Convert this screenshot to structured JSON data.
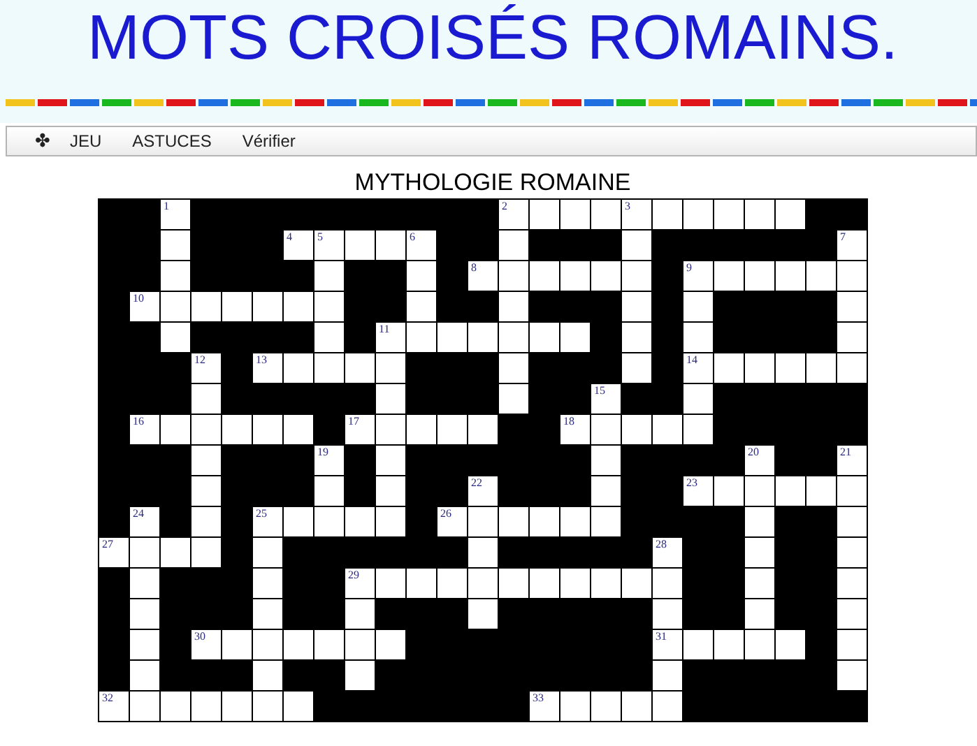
{
  "header": {
    "title": "MOTS CROISÉS ROMAINS."
  },
  "menu": [
    {
      "label": "✤"
    },
    {
      "label": "JEU"
    },
    {
      "label": "ASTUCES"
    },
    {
      "label": "Vérifier"
    }
  ],
  "puzzle": {
    "title": "MYTHOLOGIE ROMAINE",
    "rows": [
      [
        {
          "black": true
        },
        {
          "black": true
        },
        {
          "black": false,
          "number": "1"
        },
        {
          "black": true
        },
        {
          "black": true
        },
        {
          "black": true
        },
        {
          "black": true
        },
        {
          "black": true
        },
        {
          "black": true
        },
        {
          "black": true
        },
        {
          "black": true
        },
        {
          "black": true
        },
        {
          "black": true
        },
        {
          "black": false,
          "number": "2"
        },
        {
          "black": false
        },
        {
          "black": false
        },
        {
          "black": false
        },
        {
          "black": false,
          "number": "3"
        },
        {
          "black": false
        },
        {
          "black": false
        },
        {
          "black": false
        },
        {
          "black": false
        },
        {
          "black": false
        },
        {
          "black": true
        },
        {
          "black": true
        }
      ],
      [
        {
          "black": true
        },
        {
          "black": true
        },
        {
          "black": false
        },
        {
          "black": true
        },
        {
          "black": true
        },
        {
          "black": true
        },
        {
          "black": false,
          "number": "4"
        },
        {
          "black": false,
          "number": "5"
        },
        {
          "black": false
        },
        {
          "black": false
        },
        {
          "black": false,
          "number": "6"
        },
        {
          "black": true
        },
        {
          "black": true
        },
        {
          "black": false
        },
        {
          "black": true
        },
        {
          "black": true
        },
        {
          "black": true
        },
        {
          "black": false
        },
        {
          "black": true
        },
        {
          "black": true
        },
        {
          "black": true
        },
        {
          "black": true
        },
        {
          "black": true
        },
        {
          "black": true
        },
        {
          "black": false,
          "number": "7"
        }
      ],
      [
        {
          "black": true
        },
        {
          "black": true
        },
        {
          "black": false
        },
        {
          "black": true
        },
        {
          "black": true
        },
        {
          "black": true
        },
        {
          "black": true
        },
        {
          "black": false
        },
        {
          "black": true
        },
        {
          "black": true
        },
        {
          "black": false
        },
        {
          "black": true
        },
        {
          "black": false,
          "number": "8"
        },
        {
          "black": false
        },
        {
          "black": false
        },
        {
          "black": false
        },
        {
          "black": false
        },
        {
          "black": false
        },
        {
          "black": true
        },
        {
          "black": false,
          "number": "9"
        },
        {
          "black": false
        },
        {
          "black": false
        },
        {
          "black": false
        },
        {
          "black": false
        },
        {
          "black": false
        }
      ],
      [
        {
          "black": true
        },
        {
          "black": false,
          "number": "10"
        },
        {
          "black": false
        },
        {
          "black": false
        },
        {
          "black": false
        },
        {
          "black": false
        },
        {
          "black": false
        },
        {
          "black": false
        },
        {
          "black": true
        },
        {
          "black": true
        },
        {
          "black": false
        },
        {
          "black": true
        },
        {
          "black": true
        },
        {
          "black": false
        },
        {
          "black": true
        },
        {
          "black": true
        },
        {
          "black": true
        },
        {
          "black": false
        },
        {
          "black": true
        },
        {
          "black": false
        },
        {
          "black": true
        },
        {
          "black": true
        },
        {
          "black": true
        },
        {
          "black": true
        },
        {
          "black": false
        }
      ],
      [
        {
          "black": true
        },
        {
          "black": true
        },
        {
          "black": false
        },
        {
          "black": true
        },
        {
          "black": true
        },
        {
          "black": true
        },
        {
          "black": true
        },
        {
          "black": false
        },
        {
          "black": true
        },
        {
          "black": false,
          "number": "11"
        },
        {
          "black": false
        },
        {
          "black": false
        },
        {
          "black": false
        },
        {
          "black": false
        },
        {
          "black": false
        },
        {
          "black": false
        },
        {
          "black": true
        },
        {
          "black": false
        },
        {
          "black": true
        },
        {
          "black": false
        },
        {
          "black": true
        },
        {
          "black": true
        },
        {
          "black": true
        },
        {
          "black": true
        },
        {
          "black": false
        }
      ],
      [
        {
          "black": true
        },
        {
          "black": true
        },
        {
          "black": true
        },
        {
          "black": false,
          "number": "12"
        },
        {
          "black": true
        },
        {
          "black": false,
          "number": "13"
        },
        {
          "black": false
        },
        {
          "black": false
        },
        {
          "black": false
        },
        {
          "black": false
        },
        {
          "black": true
        },
        {
          "black": true
        },
        {
          "black": true
        },
        {
          "black": false
        },
        {
          "black": true
        },
        {
          "black": true
        },
        {
          "black": true
        },
        {
          "black": false
        },
        {
          "black": true
        },
        {
          "black": false,
          "number": "14"
        },
        {
          "black": false
        },
        {
          "black": false
        },
        {
          "black": false
        },
        {
          "black": false
        },
        {
          "black": false
        }
      ],
      [
        {
          "black": true
        },
        {
          "black": true
        },
        {
          "black": true
        },
        {
          "black": false
        },
        {
          "black": true
        },
        {
          "black": true
        },
        {
          "black": true
        },
        {
          "black": true
        },
        {
          "black": true
        },
        {
          "black": false
        },
        {
          "black": true
        },
        {
          "black": true
        },
        {
          "black": true
        },
        {
          "black": false
        },
        {
          "black": true
        },
        {
          "black": true
        },
        {
          "black": false,
          "number": "15"
        },
        {
          "black": true
        },
        {
          "black": true
        },
        {
          "black": false
        },
        {
          "black": true
        },
        {
          "black": true
        },
        {
          "black": true
        },
        {
          "black": true
        },
        {
          "black": true
        }
      ],
      [
        {
          "black": true
        },
        {
          "black": false,
          "number": "16"
        },
        {
          "black": false
        },
        {
          "black": false
        },
        {
          "black": false
        },
        {
          "black": false
        },
        {
          "black": false
        },
        {
          "black": true
        },
        {
          "black": false,
          "number": "17"
        },
        {
          "black": false
        },
        {
          "black": false
        },
        {
          "black": false
        },
        {
          "black": false
        },
        {
          "black": true
        },
        {
          "black": true
        },
        {
          "black": false,
          "number": "18"
        },
        {
          "black": false
        },
        {
          "black": false
        },
        {
          "black": false
        },
        {
          "black": false
        },
        {
          "black": true
        },
        {
          "black": true
        },
        {
          "black": true
        },
        {
          "black": true
        },
        {
          "black": true
        }
      ],
      [
        {
          "black": true
        },
        {
          "black": true
        },
        {
          "black": true
        },
        {
          "black": false
        },
        {
          "black": true
        },
        {
          "black": true
        },
        {
          "black": true
        },
        {
          "black": false,
          "number": "19"
        },
        {
          "black": true
        },
        {
          "black": false
        },
        {
          "black": true
        },
        {
          "black": true
        },
        {
          "black": true
        },
        {
          "black": true
        },
        {
          "black": true
        },
        {
          "black": true
        },
        {
          "black": false
        },
        {
          "black": true
        },
        {
          "black": true
        },
        {
          "black": true
        },
        {
          "black": true
        },
        {
          "black": false,
          "number": "20"
        },
        {
          "black": true
        },
        {
          "black": true
        },
        {
          "black": false,
          "number": "21"
        }
      ],
      [
        {
          "black": true
        },
        {
          "black": true
        },
        {
          "black": true
        },
        {
          "black": false
        },
        {
          "black": true
        },
        {
          "black": true
        },
        {
          "black": true
        },
        {
          "black": false
        },
        {
          "black": true
        },
        {
          "black": false
        },
        {
          "black": true
        },
        {
          "black": true
        },
        {
          "black": false,
          "number": "22"
        },
        {
          "black": true
        },
        {
          "black": true
        },
        {
          "black": true
        },
        {
          "black": false
        },
        {
          "black": true
        },
        {
          "black": true
        },
        {
          "black": false,
          "number": "23"
        },
        {
          "black": false
        },
        {
          "black": false
        },
        {
          "black": false
        },
        {
          "black": false
        },
        {
          "black": false
        }
      ],
      [
        {
          "black": true
        },
        {
          "black": false,
          "number": "24"
        },
        {
          "black": true
        },
        {
          "black": false
        },
        {
          "black": true
        },
        {
          "black": false,
          "number": "25"
        },
        {
          "black": false
        },
        {
          "black": false
        },
        {
          "black": false
        },
        {
          "black": false
        },
        {
          "black": true
        },
        {
          "black": false,
          "number": "26"
        },
        {
          "black": false
        },
        {
          "black": false
        },
        {
          "black": false
        },
        {
          "black": false
        },
        {
          "black": false
        },
        {
          "black": true
        },
        {
          "black": true
        },
        {
          "black": true
        },
        {
          "black": true
        },
        {
          "black": false
        },
        {
          "black": true
        },
        {
          "black": true
        },
        {
          "black": false
        }
      ],
      [
        {
          "black": false,
          "number": "27"
        },
        {
          "black": false
        },
        {
          "black": false
        },
        {
          "black": false
        },
        {
          "black": true
        },
        {
          "black": false
        },
        {
          "black": true
        },
        {
          "black": true
        },
        {
          "black": true
        },
        {
          "black": true
        },
        {
          "black": true
        },
        {
          "black": true
        },
        {
          "black": false
        },
        {
          "black": true
        },
        {
          "black": true
        },
        {
          "black": true
        },
        {
          "black": true
        },
        {
          "black": true
        },
        {
          "black": false,
          "number": "28"
        },
        {
          "black": true
        },
        {
          "black": true
        },
        {
          "black": false
        },
        {
          "black": true
        },
        {
          "black": true
        },
        {
          "black": false
        }
      ],
      [
        {
          "black": true
        },
        {
          "black": false
        },
        {
          "black": true
        },
        {
          "black": true
        },
        {
          "black": true
        },
        {
          "black": false
        },
        {
          "black": true
        },
        {
          "black": true
        },
        {
          "black": false,
          "number": "29"
        },
        {
          "black": false
        },
        {
          "black": false
        },
        {
          "black": false
        },
        {
          "black": false
        },
        {
          "black": false
        },
        {
          "black": false
        },
        {
          "black": false
        },
        {
          "black": false
        },
        {
          "black": false
        },
        {
          "black": false
        },
        {
          "black": true
        },
        {
          "black": true
        },
        {
          "black": false
        },
        {
          "black": true
        },
        {
          "black": true
        },
        {
          "black": false
        }
      ],
      [
        {
          "black": true
        },
        {
          "black": false
        },
        {
          "black": true
        },
        {
          "black": true
        },
        {
          "black": true
        },
        {
          "black": false
        },
        {
          "black": true
        },
        {
          "black": true
        },
        {
          "black": false
        },
        {
          "black": true
        },
        {
          "black": true
        },
        {
          "black": true
        },
        {
          "black": false
        },
        {
          "black": true
        },
        {
          "black": true
        },
        {
          "black": true
        },
        {
          "black": true
        },
        {
          "black": true
        },
        {
          "black": false
        },
        {
          "black": true
        },
        {
          "black": true
        },
        {
          "black": false
        },
        {
          "black": true
        },
        {
          "black": true
        },
        {
          "black": false
        }
      ],
      [
        {
          "black": true
        },
        {
          "black": false
        },
        {
          "black": true
        },
        {
          "black": false,
          "number": "30"
        },
        {
          "black": false
        },
        {
          "black": false
        },
        {
          "black": false
        },
        {
          "black": false
        },
        {
          "black": false
        },
        {
          "black": false
        },
        {
          "black": true
        },
        {
          "black": true
        },
        {
          "black": true
        },
        {
          "black": true
        },
        {
          "black": true
        },
        {
          "black": true
        },
        {
          "black": true
        },
        {
          "black": true
        },
        {
          "black": false,
          "number": "31"
        },
        {
          "black": false
        },
        {
          "black": false
        },
        {
          "black": false
        },
        {
          "black": false
        },
        {
          "black": true
        },
        {
          "black": false
        }
      ],
      [
        {
          "black": true
        },
        {
          "black": false
        },
        {
          "black": true
        },
        {
          "black": true
        },
        {
          "black": true
        },
        {
          "black": false
        },
        {
          "black": true
        },
        {
          "black": true
        },
        {
          "black": false
        },
        {
          "black": true
        },
        {
          "black": true
        },
        {
          "black": true
        },
        {
          "black": true
        },
        {
          "black": true
        },
        {
          "black": true
        },
        {
          "black": true
        },
        {
          "black": true
        },
        {
          "black": true
        },
        {
          "black": false
        },
        {
          "black": true
        },
        {
          "black": true
        },
        {
          "black": true
        },
        {
          "black": true
        },
        {
          "black": true
        },
        {
          "black": false
        }
      ],
      [
        {
          "black": false,
          "number": "32"
        },
        {
          "black": false
        },
        {
          "black": false
        },
        {
          "black": false
        },
        {
          "black": false
        },
        {
          "black": false
        },
        {
          "black": false
        },
        {
          "black": true
        },
        {
          "black": true
        },
        {
          "black": true
        },
        {
          "black": true
        },
        {
          "black": true
        },
        {
          "black": true
        },
        {
          "black": true
        },
        {
          "black": false,
          "number": "33"
        },
        {
          "black": false
        },
        {
          "black": false
        },
        {
          "black": false
        },
        {
          "black": false
        },
        {
          "black": true
        },
        {
          "black": true
        },
        {
          "black": true
        },
        {
          "black": true
        },
        {
          "black": true
        },
        {
          "black": true
        }
      ]
    ]
  }
}
